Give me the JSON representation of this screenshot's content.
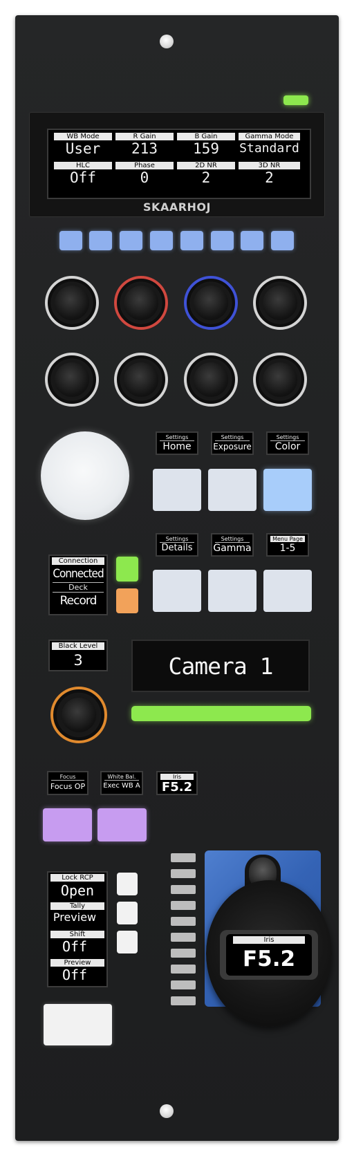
{
  "main_display": {
    "row1_labels": [
      "WB Mode",
      "R Gain",
      "B Gain",
      "Gamma Mode"
    ],
    "row1_values": [
      "User",
      "213",
      "159",
      "Standard"
    ],
    "row2_labels": [
      "HLC",
      "Phase",
      "2D NR",
      "3D NR"
    ],
    "row2_values": [
      "Off",
      "0",
      "2",
      "2"
    ]
  },
  "brand": "SKAARHOJ",
  "menu_row1": [
    {
      "title": "Settings",
      "value": "Home"
    },
    {
      "title": "Settings",
      "value": "Exposure"
    },
    {
      "title": "Settings",
      "value": "Color"
    }
  ],
  "menu_row2": [
    {
      "title": "Settings",
      "value": "Details"
    },
    {
      "title": "Settings",
      "value": "Gamma"
    },
    {
      "title": "Menu Page",
      "value": "1-5"
    }
  ],
  "connection": {
    "title": "Connection",
    "value": "Connected",
    "deck_title": "Deck",
    "deck_value": "Record"
  },
  "black_level": {
    "title": "Black Level",
    "value": "3"
  },
  "camera_display": "Camera 1",
  "lens_row": [
    {
      "title": "Focus",
      "value": "Focus OP"
    },
    {
      "title": "White Bal.",
      "value": "Exec WB A"
    },
    {
      "title": "Iris",
      "value": "F5.2"
    }
  ],
  "status_stack": [
    {
      "title": "Lock RCP",
      "value": "Open"
    },
    {
      "title": "Tally",
      "value": "Preview"
    },
    {
      "title": "Shift",
      "value": "Off"
    },
    {
      "title": "Preview",
      "value": "Off"
    }
  ],
  "joystick_display": {
    "title": "Iris",
    "value": "F5.2"
  },
  "colors": {
    "blue_button": "#8fb0ee",
    "green_led": "#8de84e",
    "orange_button": "#f2a25a",
    "purple_button": "#c79cf0",
    "red_ring": "#d0483f",
    "blue_ring": "#3f52d6",
    "orange_ring": "#e08a2e"
  }
}
